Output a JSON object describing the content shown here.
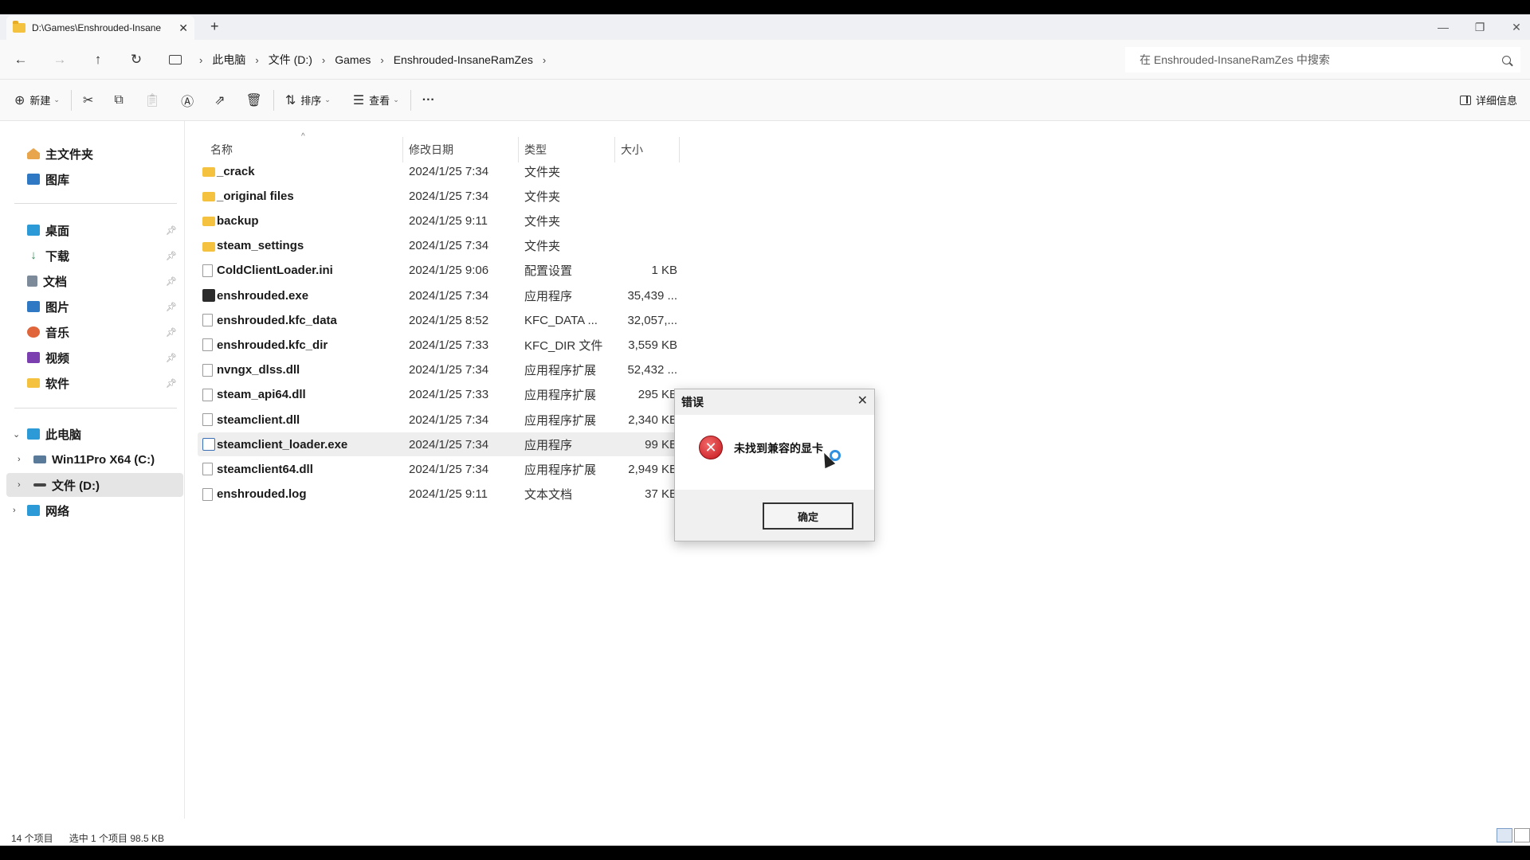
{
  "tab": {
    "label": "D:\\Games\\Enshrouded-Insane",
    "close": "✕",
    "new_tab": "+"
  },
  "window_controls": {
    "minimize": "—",
    "maximize": "❐",
    "close": "✕"
  },
  "nav": {
    "back": "←",
    "forward": "→",
    "up": "↑",
    "refresh": "↻"
  },
  "breadcrumb": [
    "此电脑",
    "文件 (D:)",
    "Games",
    "Enshrouded-InsaneRamZes"
  ],
  "search": {
    "placeholder": "在 Enshrouded-InsaneRamZes 中搜索"
  },
  "command_bar": {
    "new_label": "新建",
    "sort_label": "排序",
    "view_label": "查看",
    "more": "···",
    "details_label": "详细信息"
  },
  "sidebar": {
    "top": [
      {
        "label": "主文件夹",
        "icon": "home-icon"
      },
      {
        "label": "图库",
        "icon": "gallery-icon"
      }
    ],
    "pinned": [
      {
        "label": "桌面",
        "icon": "desktop-icon",
        "color": "#2d9ad8"
      },
      {
        "label": "下载",
        "icon": "download-icon",
        "color": "#2e8b57"
      },
      {
        "label": "文档",
        "icon": "documents-icon",
        "color": "#7d8a99"
      },
      {
        "label": "图片",
        "icon": "pictures-icon",
        "color": "#2f78c4"
      },
      {
        "label": "音乐",
        "icon": "music-icon",
        "color": "#e0653a"
      },
      {
        "label": "视频",
        "icon": "videos-icon",
        "color": "#7b3fb0"
      },
      {
        "label": "软件",
        "icon": "folder-icon",
        "color": "#f4c23e"
      }
    ],
    "tree": [
      {
        "label": "此电脑",
        "chevron": "⌄"
      },
      {
        "label": "Win11Pro X64 (C:)",
        "chevron": "›"
      },
      {
        "label": "文件 (D:)",
        "chevron": "›"
      },
      {
        "label": "网络",
        "chevron": "›"
      }
    ]
  },
  "columns": {
    "name": "名称",
    "date": "修改日期",
    "type": "类型",
    "size": "大小"
  },
  "files": [
    {
      "name": "_crack",
      "date": "2024/1/25 7:34",
      "type": "文件夹",
      "size": "",
      "icon": "folder"
    },
    {
      "name": "_original files",
      "date": "2024/1/25 7:34",
      "type": "文件夹",
      "size": "",
      "icon": "folder"
    },
    {
      "name": "backup",
      "date": "2024/1/25 9:11",
      "type": "文件夹",
      "size": "",
      "icon": "folder"
    },
    {
      "name": "steam_settings",
      "date": "2024/1/25 7:34",
      "type": "文件夹",
      "size": "",
      "icon": "folder"
    },
    {
      "name": "ColdClientLoader.ini",
      "date": "2024/1/25 9:06",
      "type": "配置设置",
      "size": "1 KB",
      "icon": "file"
    },
    {
      "name": "enshrouded.exe",
      "date": "2024/1/25 7:34",
      "type": "应用程序",
      "size": "35,439 ...",
      "icon": "exe"
    },
    {
      "name": "enshrouded.kfc_data",
      "date": "2024/1/25 8:52",
      "type": "KFC_DATA ...",
      "size": "32,057,...",
      "icon": "file"
    },
    {
      "name": "enshrouded.kfc_dir",
      "date": "2024/1/25 7:33",
      "type": "KFC_DIR 文件",
      "size": "3,559 KB",
      "icon": "file"
    },
    {
      "name": "nvngx_dlss.dll",
      "date": "2024/1/25 7:34",
      "type": "应用程序扩展",
      "size": "52,432 ...",
      "icon": "file"
    },
    {
      "name": "steam_api64.dll",
      "date": "2024/1/25 7:33",
      "type": "应用程序扩展",
      "size": "295 KB",
      "icon": "file"
    },
    {
      "name": "steamclient.dll",
      "date": "2024/1/25 7:34",
      "type": "应用程序扩展",
      "size": "2,340 KB",
      "icon": "file"
    },
    {
      "name": "steamclient_loader.exe",
      "date": "2024/1/25 7:34",
      "type": "应用程序",
      "size": "99 KB",
      "icon": "exe2",
      "selected": true
    },
    {
      "name": "steamclient64.dll",
      "date": "2024/1/25 7:34",
      "type": "应用程序扩展",
      "size": "2,949 KB",
      "icon": "file"
    },
    {
      "name": "enshrouded.log",
      "date": "2024/1/25 9:11",
      "type": "文本文档",
      "size": "37 KB",
      "icon": "file"
    }
  ],
  "status": {
    "count": "14 个项目",
    "selection": "选中 1 个项目  98.5 KB"
  },
  "dialog": {
    "title": "错误",
    "close": "✕",
    "icon": "error-icon",
    "message": "未找到兼容的显卡",
    "ok_label": "确定"
  }
}
